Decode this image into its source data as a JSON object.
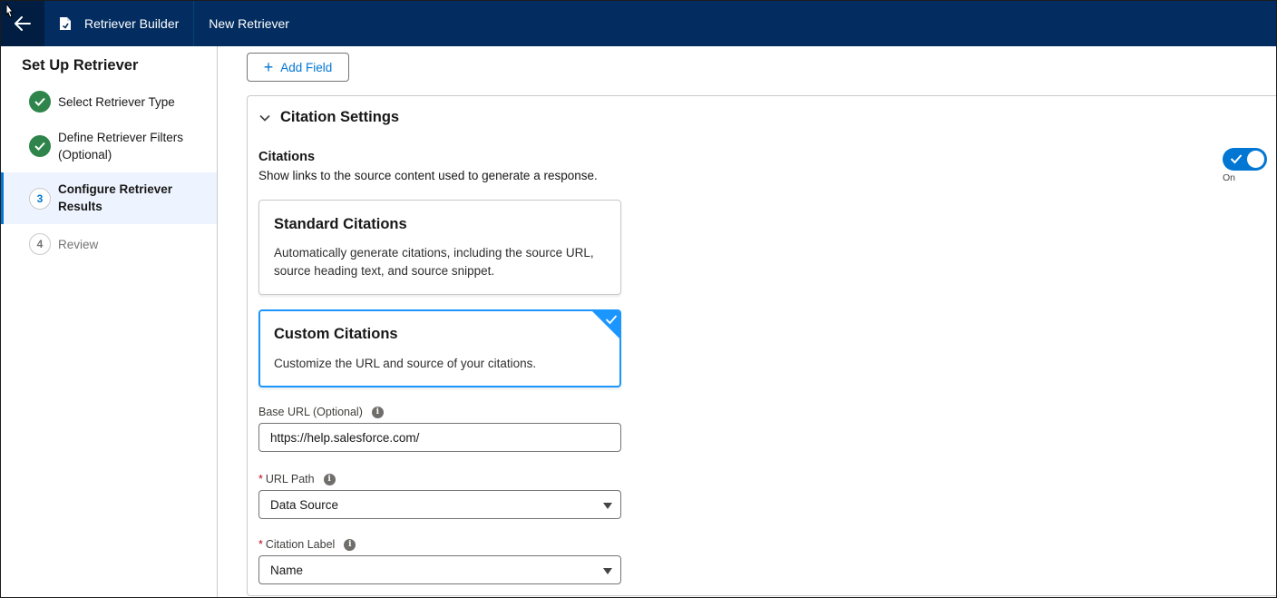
{
  "header": {
    "back_icon": "arrow-left-icon",
    "app_icon": "document-icon",
    "app_title": "Retriever Builder",
    "page_title": "New Retriever"
  },
  "sidebar": {
    "title": "Set Up Retriever",
    "steps": [
      {
        "number": "1",
        "label": "Select Retriever Type",
        "state": "complete"
      },
      {
        "number": "2",
        "label_line1": "Define Retriever Filters",
        "label_line2": "(Optional)",
        "state": "complete"
      },
      {
        "number": "3",
        "label_line1": "Configure Retriever",
        "label_line2": "Results",
        "state": "current"
      },
      {
        "number": "4",
        "label": "Review",
        "state": "incomplete"
      }
    ]
  },
  "main": {
    "add_field_label": "Add Field",
    "section": {
      "title": "Citation Settings",
      "citations_label": "Citations",
      "citations_desc": "Show links to the source content used to generate a response.",
      "toggle_state_label": "On",
      "toggle_on": true,
      "cards": [
        {
          "title": "Standard Citations",
          "desc_line1": "Automatically generate citations, including the source URL,",
          "desc_line2": "source heading text, and source snippet.",
          "selected": false
        },
        {
          "title": "Custom Citations",
          "desc": "Customize the URL and source of your citations.",
          "selected": true
        }
      ],
      "fields": {
        "base_url": {
          "label": "Base URL (Optional)",
          "value": "https://help.salesforce.com/"
        },
        "url_path": {
          "required_mark": "*",
          "label": "URL Path",
          "value": "Data Source"
        },
        "citation_label": {
          "required_mark": "*",
          "label": "Citation Label",
          "value": "Name"
        }
      }
    }
  },
  "colors": {
    "header_bg": "#032d60",
    "brand_blue": "#0176d3",
    "success_green": "#2e844a",
    "selected_border": "#1b96ff"
  }
}
